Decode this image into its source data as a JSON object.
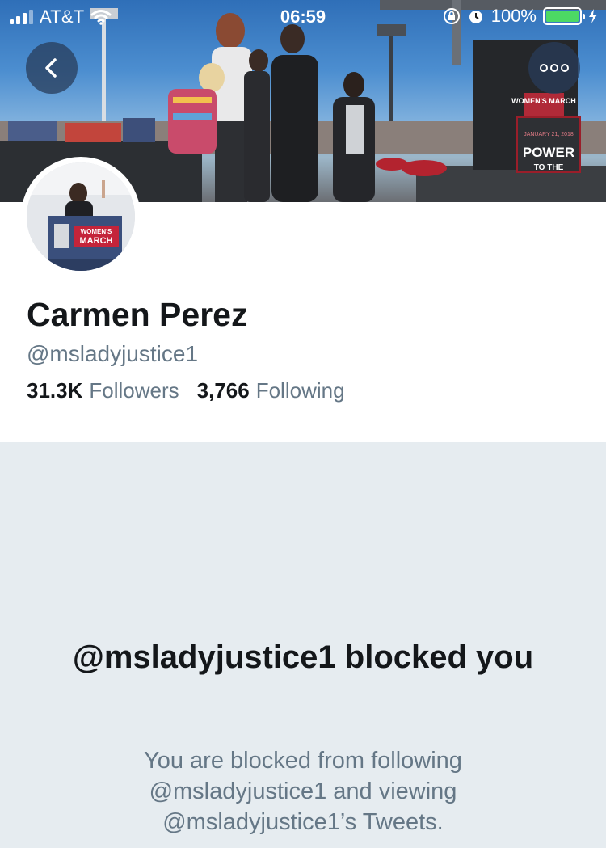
{
  "status_bar": {
    "carrier": "AT&T",
    "time": "06:59",
    "battery_percent": "100%",
    "signal_bars": 3,
    "battery_level": 1.0
  },
  "header": {
    "back_icon": "chevron-left-icon",
    "more_icon": "ellipsis-icon"
  },
  "banner_signs": {
    "womens_march": "WOMEN'S MARCH",
    "date": "JANUARY 21, 2018",
    "power": "POWER",
    "to_the": "TO THE"
  },
  "avatar_signs": {
    "line1": "WOMEN'S",
    "line2": "MARCH"
  },
  "profile": {
    "display_name": "Carmen Perez",
    "handle": "@msladyjustice1",
    "followers_count": "31.3K",
    "followers_label": "Followers",
    "following_count": "3,766",
    "following_label": "Following"
  },
  "blocked": {
    "title": "@msladyjustice1 blocked you",
    "description": "You are blocked from following @msladyjustice1 and viewing @msladyjustice1’s Tweets."
  },
  "colors": {
    "background": "#e6ecf0",
    "card": "#ffffff",
    "text_primary": "#14171a",
    "text_secondary": "#657786",
    "battery": "#4cd964"
  }
}
